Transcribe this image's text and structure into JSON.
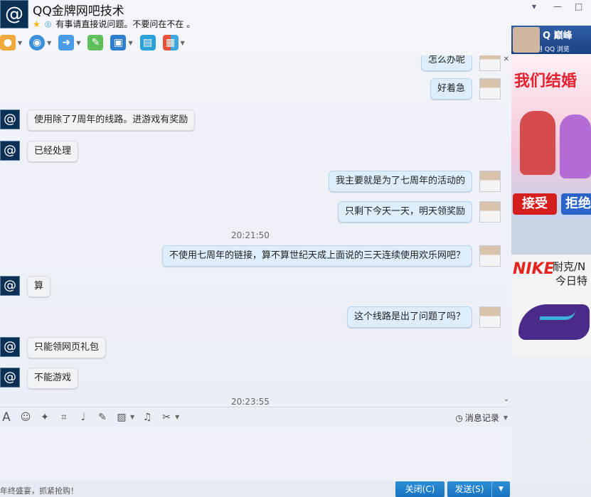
{
  "window": {
    "title": "QQ金牌网吧技术",
    "status_message": "有事请直接说问题。不要问在不在 。",
    "controls": {
      "minimize": "▾",
      "restore": "—",
      "maximize": "□"
    }
  },
  "toolbar": {
    "items": [
      "voice-icon",
      "video-icon",
      "file-transfer-icon",
      "message-icon",
      "remote-desktop-icon",
      "share-screen-icon",
      "apps-icon"
    ]
  },
  "messages": [
    {
      "side": "me",
      "text": "怎么办呢"
    },
    {
      "side": "me",
      "text": "好着急"
    },
    {
      "side": "them",
      "text": "使用除了7周年的线路。进游戏有奖励"
    },
    {
      "side": "them",
      "text": "已经处理"
    },
    {
      "side": "me",
      "text": "我主要就是为了七周年的活动的"
    },
    {
      "side": "me",
      "text": "只剩下今天一天，明天领奖励"
    },
    {
      "time": "20:21:50"
    },
    {
      "side": "me",
      "text": "不使用七周年的链接，算不算世纪天成上面说的三天连续使用欢乐网吧？"
    },
    {
      "side": "them",
      "text": "算"
    },
    {
      "side": "me",
      "text": "这个线路是出了问题了吗？"
    },
    {
      "side": "them",
      "text": "只能领网页礼包"
    },
    {
      "side": "them",
      "text": "不能游戏"
    },
    {
      "time": "20:23:55"
    }
  ],
  "ads": {
    "top_brand": "Q 巅峰",
    "top_sub": "抢鲜就用 QQ 浏览",
    "wedding_title": "我们结婚",
    "accept": "接受",
    "reject": "拒绝",
    "nike_logo": "NIKE",
    "nike_name": "耐克/N",
    "nike_sub": "今日特"
  },
  "input_toolbar": {
    "icons": [
      "font-icon",
      "emoji-icon",
      "magic-icon",
      "screenshot-icon",
      "mic-icon",
      "edit-icon",
      "image-icon",
      "music-icon",
      "scissors-icon"
    ],
    "history_label": "消息记录"
  },
  "footer": {
    "promo": "年终盛宴，抓紧抢购！",
    "close_label": "关闭(C)",
    "send_label": "发送(S)"
  }
}
